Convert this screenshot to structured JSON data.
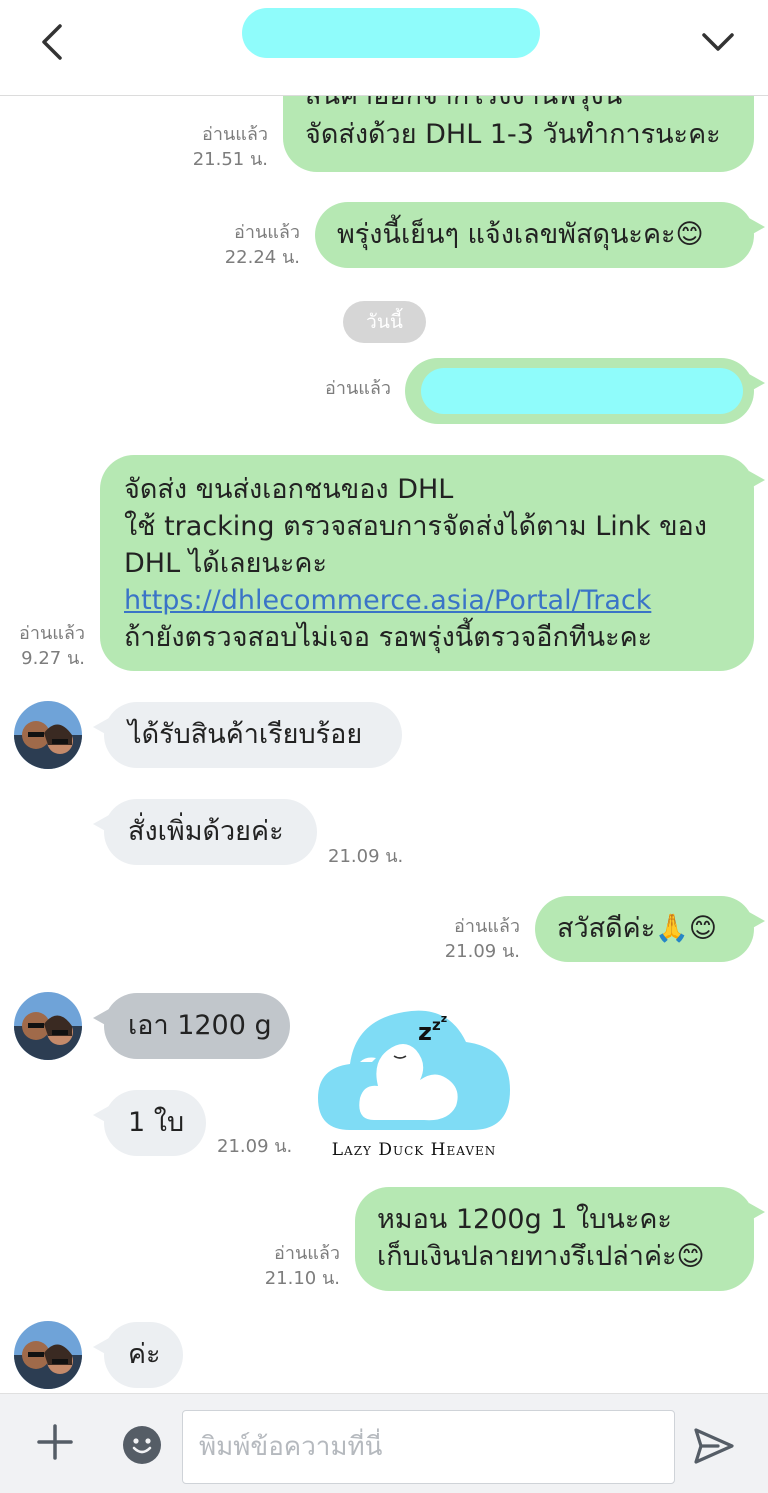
{
  "header": {
    "back_icon": "chevron-left-icon",
    "menu_icon": "chevron-down-icon",
    "title_redacted_color": "#8ffcfb"
  },
  "colors": {
    "outgoing_bubble": "#b6e8b3",
    "incoming_bubble": "#eceff2",
    "incoming_bubble_dark": "#c1c6cb",
    "link": "#3a74c7"
  },
  "messages": {
    "m1": {
      "partial_line": "สินค้าออกจากโรงงานพรุ่งนี้",
      "line": "จัดส่งด้วย DHL 1-3 วันทำการนะคะ",
      "read": "อ่านแล้ว",
      "time": "21.51 น."
    },
    "m2": {
      "text": "พรุ่งนี้เย็นๆ แจ้งเลขพัสดุนะคะ😊",
      "read": "อ่านแล้ว",
      "time": "22.24 น."
    },
    "date_divider": "วันนี้",
    "m3": {
      "read": "อ่านแล้ว"
    },
    "m4": {
      "line1": "จัดส่ง ขนส่งเอกชนของ DHL",
      "line2": "ใช้ tracking ตรวจสอบการจัดส่งได้ตาม Link ของ",
      "line3": "DHL ได้เลยนะคะ",
      "link": "https://dhlecommerce.asia/Portal/Track",
      "line5": "ถ้ายังตรวจสอบไม่เจอ รอพรุ่งนี้ตรวจอีกทีนะคะ",
      "read": "อ่านแล้ว",
      "time": "9.27 น."
    },
    "m5": {
      "text": "ได้รับสินค้าเรียบร้อย"
    },
    "m6": {
      "text": "สั่งเพิ่มด้วยค่ะ",
      "time": "21.09 น."
    },
    "m7": {
      "text": "สวัสดีค่ะ🙏😊",
      "read": "อ่านแล้ว",
      "time": "21.09 น."
    },
    "m8": {
      "text": "เอา 1200 g"
    },
    "m9": {
      "text": "1 ใบ",
      "time": "21.09 น."
    },
    "sticker": {
      "caption": "Lazy Duck Heaven",
      "zzz": "z",
      "zzz2": "z",
      "zzz3": "z"
    },
    "m10": {
      "line1": "หมอน 1200g 1 ใบนะคะ",
      "line2": "เก็บเงินปลายทางรึเปล่าค่ะ😊",
      "read": "อ่านแล้ว",
      "time": "21.10 น."
    },
    "m11": {
      "text": "ค่ะ"
    }
  },
  "composer": {
    "placeholder": "พิมพ์ข้อความที่นี่",
    "plus_icon": "plus-icon",
    "emoji_icon": "emoji-icon",
    "send_icon": "send-icon"
  }
}
